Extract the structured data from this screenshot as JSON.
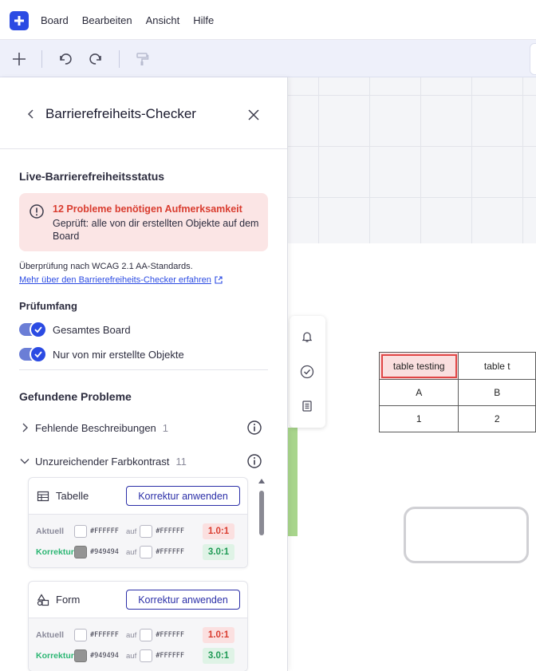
{
  "menubar": {
    "items": [
      "Board",
      "Bearbeiten",
      "Ansicht",
      "Hilfe"
    ]
  },
  "canvas": {
    "table": {
      "header": [
        "table testing",
        "table t"
      ],
      "row1": [
        "A",
        "B"
      ],
      "row2": [
        "1",
        "2"
      ]
    }
  },
  "panel": {
    "title": "Barrierefreiheits-Checker",
    "live_status_title": "Live-Barrierefreiheitsstatus",
    "alert": {
      "title": "12 Probleme benötigen Aufmerksamkeit",
      "body": "Geprüft: alle von dir erstellten Objekte auf dem Board"
    },
    "wcag_note": "Überprüfung nach WCAG 2.1 AA-Standards.",
    "learn_link": "Mehr über den Barrierefreiheits-Checker erfahren",
    "scope_title": "Prüfumfang",
    "scope_options": [
      "Gesamtes Board",
      "Nur von mir erstellte Objekte"
    ],
    "issues_title": "Gefundene Probleme",
    "categories": [
      {
        "label": "Fehlende Beschreibungen",
        "count": "1"
      },
      {
        "label": "Unzureichender Farbkontrast",
        "count": "11"
      }
    ],
    "cards": [
      {
        "title": "Tabelle",
        "fix_label": "Korrektur anwenden",
        "current_label": "Aktuell",
        "current_fg": "#FFFFFF",
        "current_bg": "#FFFFFF",
        "current_ratio": "1.0:1",
        "fix_row_label": "Korrektur",
        "fix_fg": "#949494",
        "fix_bg": "#FFFFFF",
        "fix_ratio": "3.0:1",
        "auf": "auf"
      },
      {
        "title": "Form",
        "fix_label": "Korrektur anwenden",
        "current_label": "Aktuell",
        "current_fg": "#FFFFFF",
        "current_bg": "#FFFFFF",
        "current_ratio": "1.0:1",
        "fix_row_label": "Korrektur",
        "fix_fg": "#949494",
        "fix_bg": "#FFFFFF",
        "fix_ratio": "3.0:1",
        "auf": "auf"
      }
    ]
  },
  "colors": {
    "accent": "#2b4be3",
    "error": "#d93c2f",
    "success": "#2bb673"
  }
}
